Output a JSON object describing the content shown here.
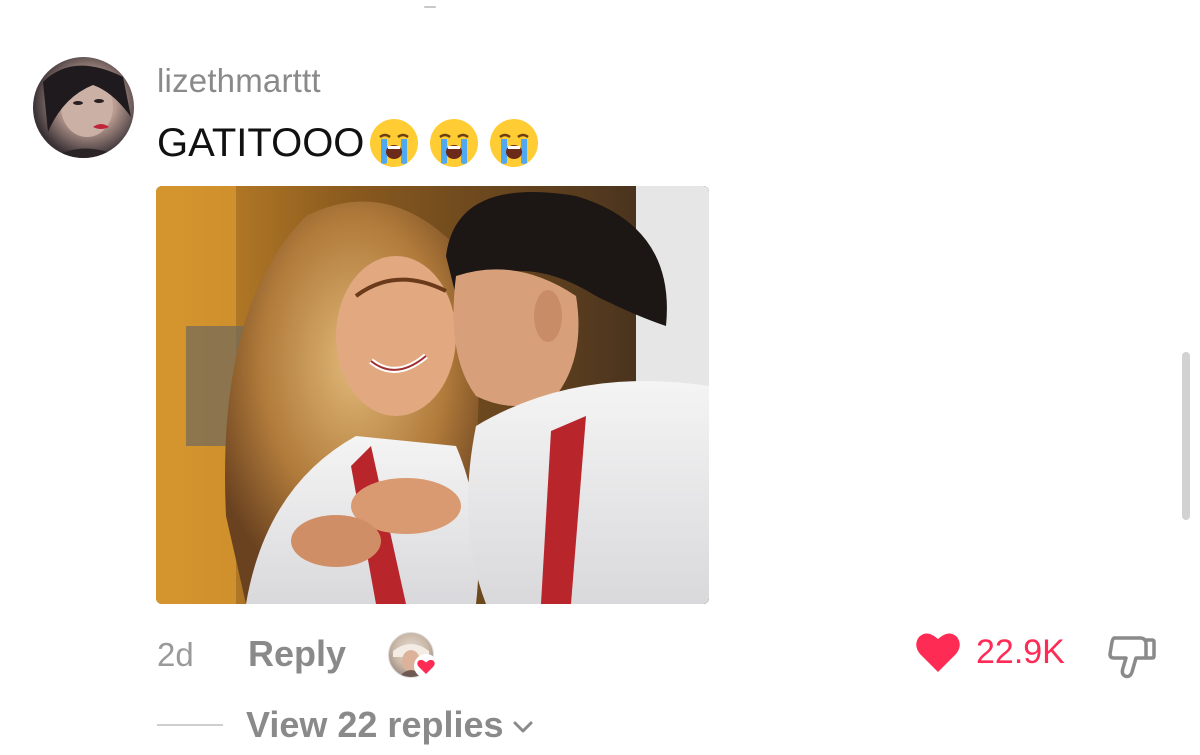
{
  "comment": {
    "username": "lizethmarttt",
    "text": "GATITOOO",
    "emojis": [
      "loudly-crying-face",
      "loudly-crying-face",
      "loudly-crying-face"
    ],
    "timestamp": "2d",
    "reply_label": "Reply",
    "likes": "22.9K",
    "liked": true,
    "creator_liked": true,
    "view_replies_label": "View 22 replies"
  },
  "colors": {
    "like_red": "#fe2c55",
    "muted_text": "#8a8a8a",
    "body_text": "#111111"
  },
  "icons": {
    "like": "heart-icon",
    "dislike": "thumbs-down-icon",
    "expand": "chevron-down-icon"
  }
}
